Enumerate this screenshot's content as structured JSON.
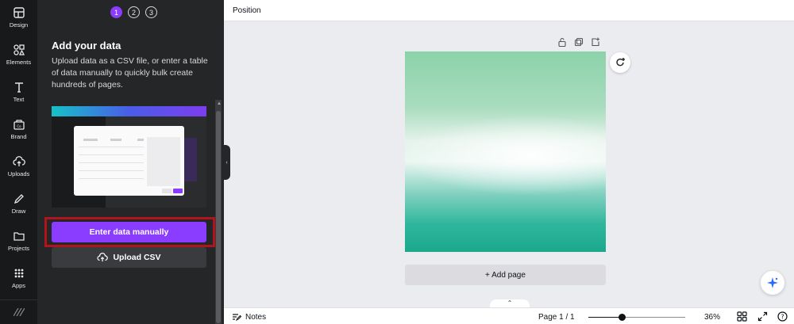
{
  "rail": {
    "items": [
      {
        "label": "Design",
        "icon": "design-icon"
      },
      {
        "label": "Elements",
        "icon": "elements-icon"
      },
      {
        "label": "Text",
        "icon": "text-icon"
      },
      {
        "label": "Brand",
        "icon": "brand-icon"
      },
      {
        "label": "Uploads",
        "icon": "upload-cloud-icon"
      },
      {
        "label": "Draw",
        "icon": "draw-icon"
      },
      {
        "label": "Projects",
        "icon": "folder-icon"
      },
      {
        "label": "Apps",
        "icon": "apps-grid-icon"
      }
    ]
  },
  "panel": {
    "steps": [
      "1",
      "2",
      "3"
    ],
    "active_step": "1",
    "title": "Add your data",
    "description": "Upload data as a CSV file, or enter a table of data manually to quickly bulk create hundreds of pages.",
    "primary_button": "Enter data manually",
    "secondary_button": "Upload CSV"
  },
  "topbar": {
    "label": "Position"
  },
  "canvas": {
    "add_page": "+ Add page"
  },
  "bottombar": {
    "notes": "Notes",
    "page_count": "Page 1 / 1",
    "zoom": "36%",
    "zoom_fraction": 0.36
  },
  "colors": {
    "accent": "#8b3dff",
    "highlight": "#b3141c",
    "rail_bg": "#18191b",
    "panel_bg": "#252627",
    "canvas_bg": "#ebecf0"
  }
}
